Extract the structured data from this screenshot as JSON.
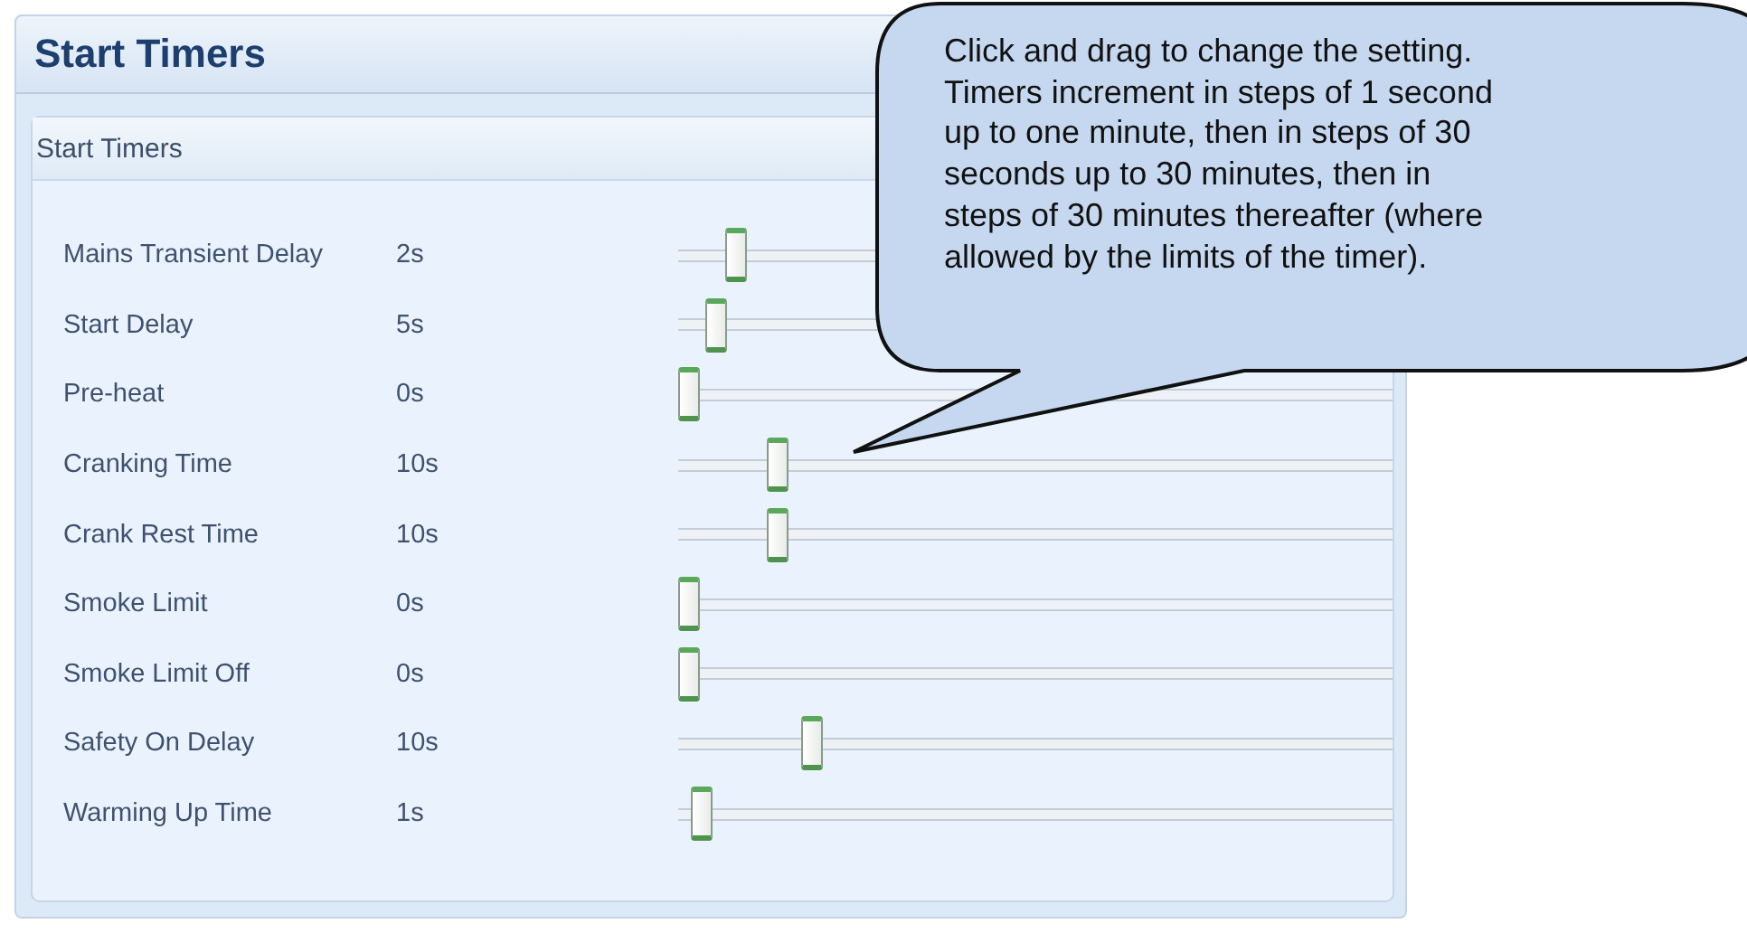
{
  "panel": {
    "title": "Start Timers"
  },
  "group": {
    "title": "Start Timers"
  },
  "timers": [
    {
      "label": "Mains Transient Delay",
      "value": "2s",
      "level": 0.07
    },
    {
      "label": "Start Delay",
      "value": "5s",
      "level": 0.04
    },
    {
      "label": "Pre-heat",
      "value": "0s",
      "level": 0
    },
    {
      "label": "Cranking Time",
      "value": "10s",
      "level": 0.13
    },
    {
      "label": "Crank Rest Time",
      "value": "10s",
      "level": 0.13
    },
    {
      "label": "Smoke Limit",
      "value": "0s",
      "level": 0
    },
    {
      "label": "Smoke Limit Off",
      "value": "0s",
      "level": 0
    },
    {
      "label": "Safety On Delay",
      "value": "10s",
      "level": 0.18
    },
    {
      "label": "Warming Up Time",
      "value": "1s",
      "level": 0.02
    }
  ],
  "callout": {
    "text": "Click and drag to change the setting. Timers increment in steps of 1 second up to one minute, then in steps of 30 seconds up to 30 minutes, then in steps of 30 minutes thereafter (where allowed by the limits of the timer)."
  }
}
